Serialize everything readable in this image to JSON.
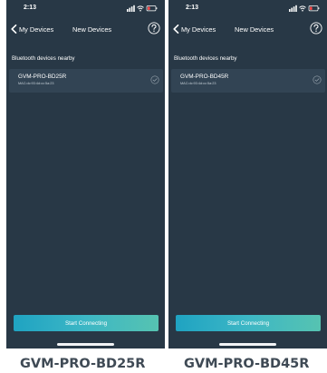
{
  "screens": [
    {
      "status_time": "2:13",
      "nav": {
        "back_label": "My Devices",
        "title": "New Devices"
      },
      "section_label": "Bluetooth devices nearby",
      "devices": [
        {
          "name": "GVM-PRO-BD25R",
          "mac": "MAC:dc:93:4d:cc:5a:23",
          "selected": true
        }
      ],
      "connect_label": "Start Connecting",
      "caption": "GVM-PRO-BD25R"
    },
    {
      "status_time": "2:13",
      "nav": {
        "back_label": "My Devices",
        "title": "New Devices"
      },
      "section_label": "Bluetooth devices nearby",
      "devices": [
        {
          "name": "GVM-PRO-BD45R",
          "mac": "MAC:dc:93:4d:cc:5a:23",
          "selected": true
        }
      ],
      "connect_label": "Start Connecting",
      "caption": "GVM-PRO-BD45R"
    }
  ],
  "icons": {
    "back": "chevron-left-icon",
    "help": "question-circle-icon",
    "selected": "check-circle-icon",
    "signal": "signal-bars-icon",
    "wifi": "wifi-icon",
    "battery": "battery-icon"
  },
  "colors": {
    "screen_background": "#283846",
    "card_background": "#324454",
    "button_gradient_start": "#1fa3c2",
    "button_gradient_end": "#56c3b1",
    "caption_text": "#3f4a55"
  }
}
